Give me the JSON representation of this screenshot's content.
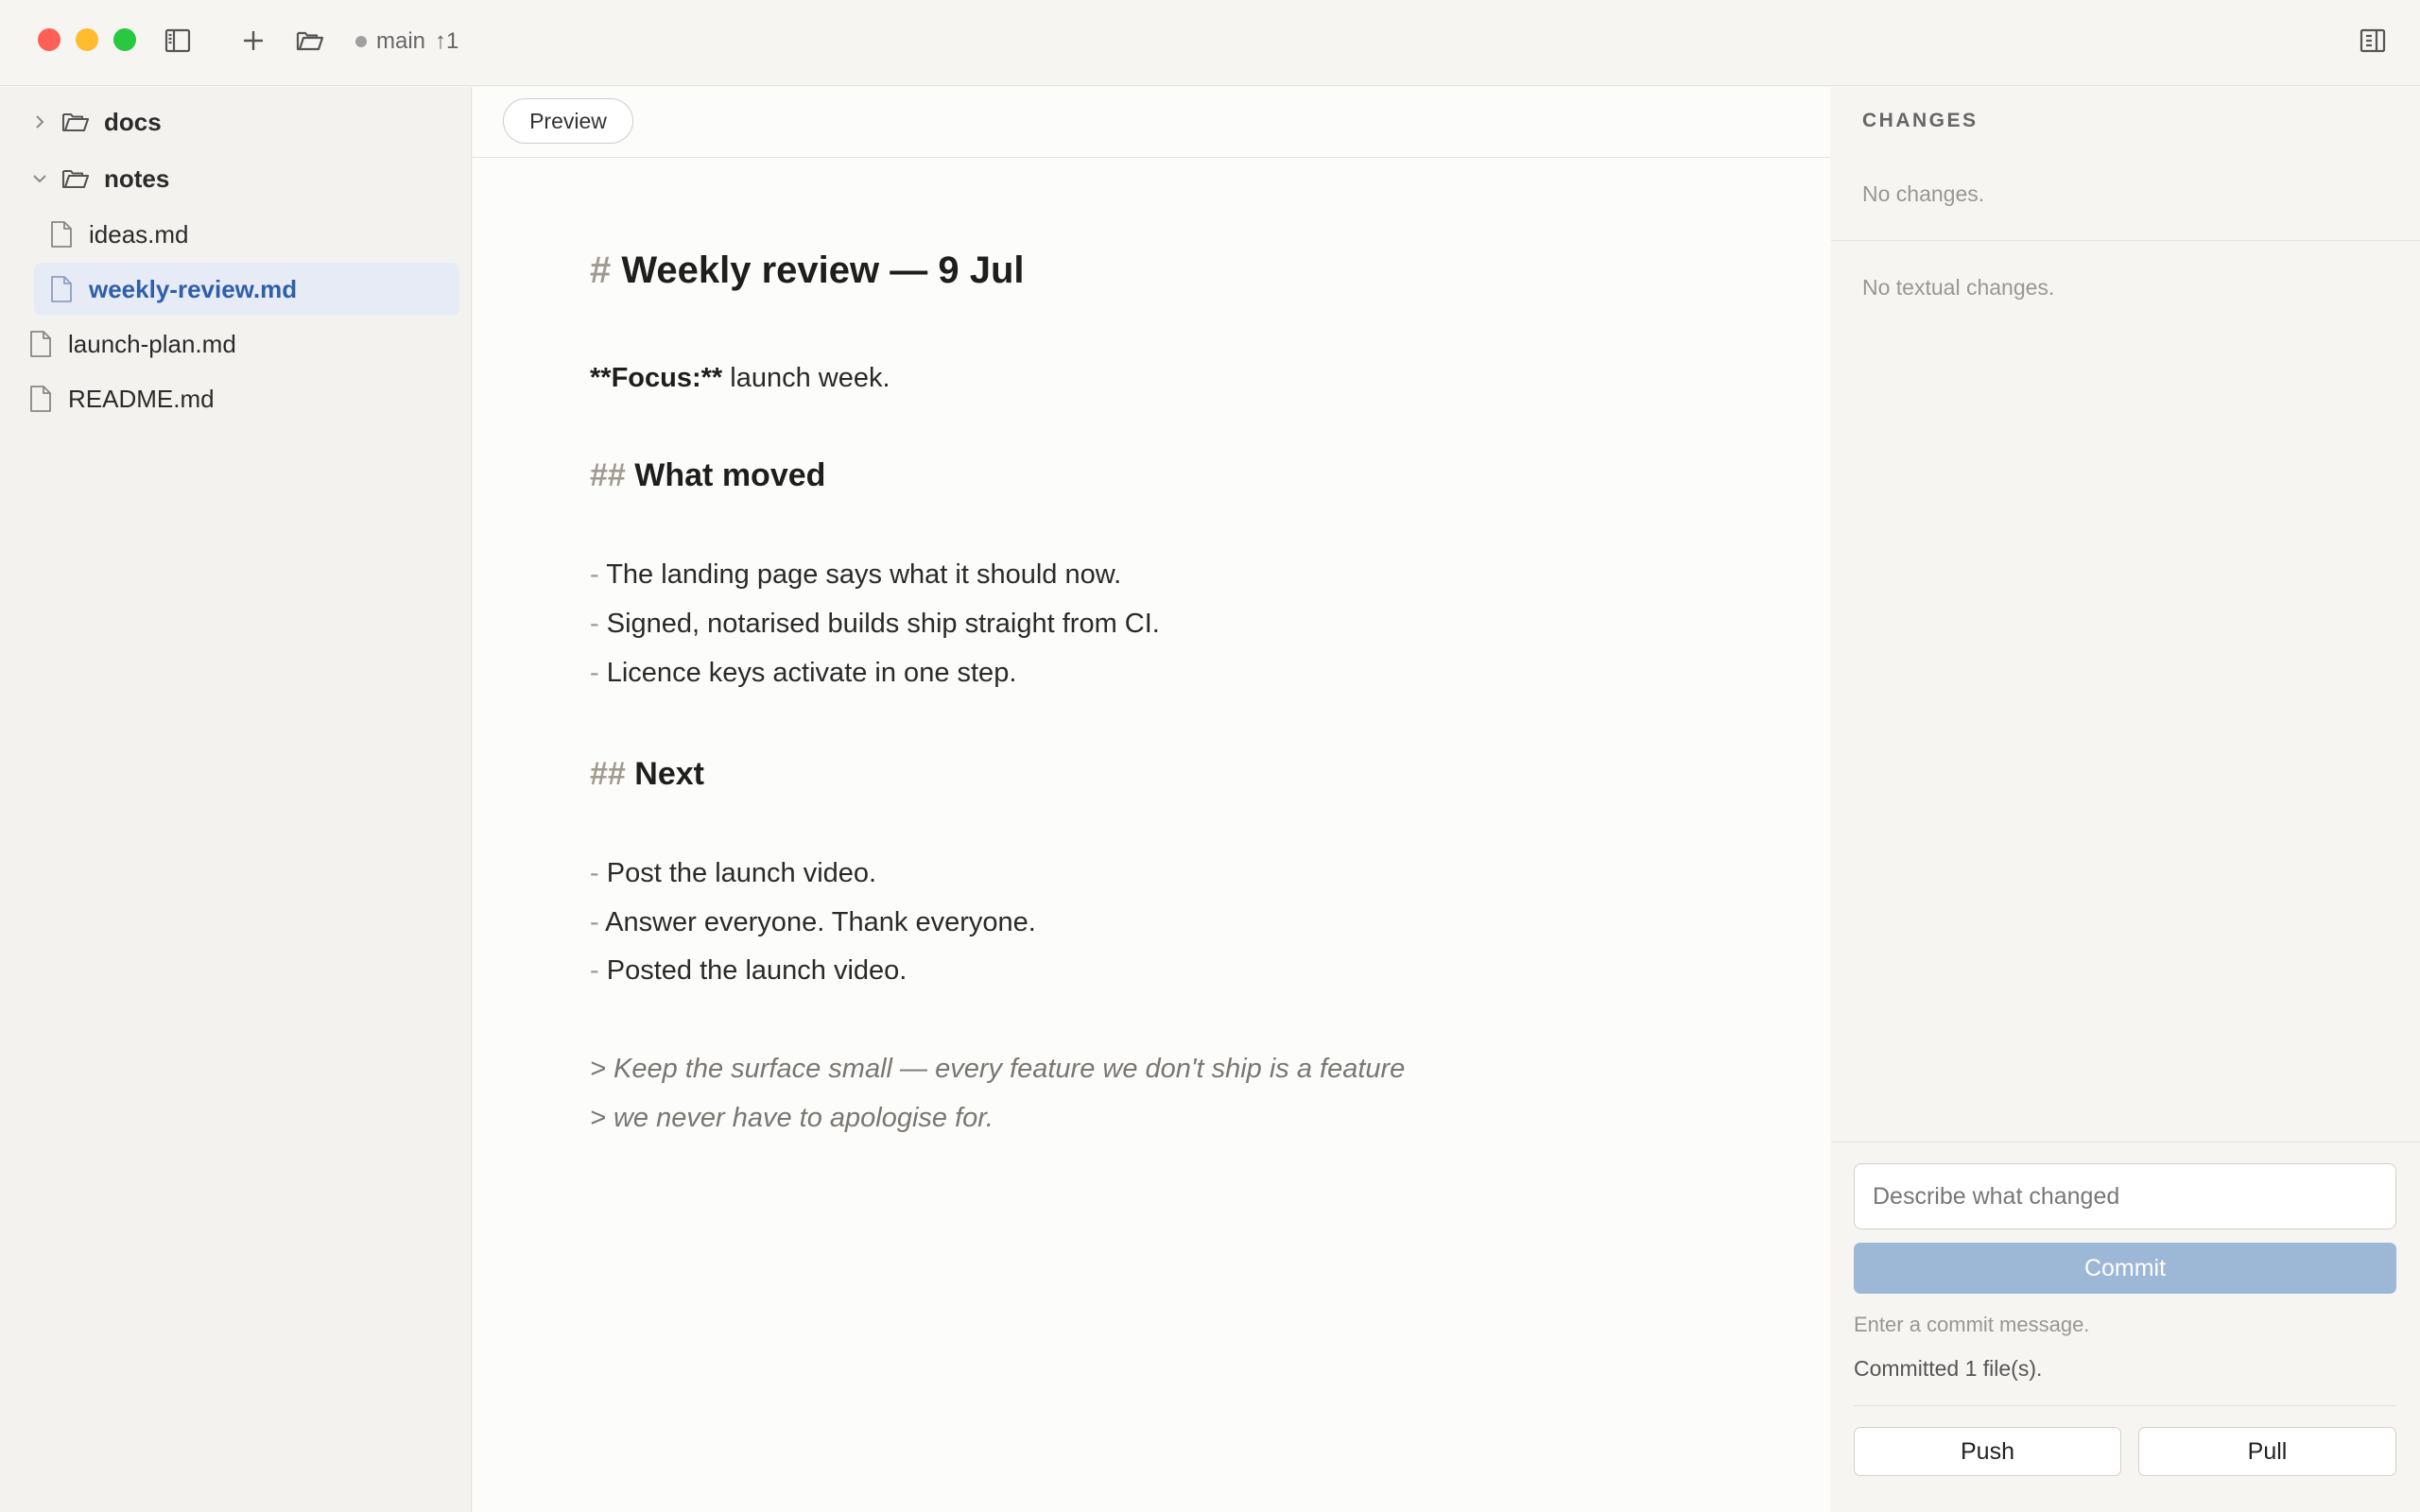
{
  "titlebar": {
    "branch": "main",
    "ahead": "↑1"
  },
  "sidebar": {
    "items": [
      {
        "label": "docs",
        "type": "folder",
        "expanded": false
      },
      {
        "label": "notes",
        "type": "folder",
        "expanded": true
      },
      {
        "label": "ideas.md",
        "type": "file"
      },
      {
        "label": "weekly-review.md",
        "type": "file",
        "selected": true
      },
      {
        "label": "launch-plan.md",
        "type": "file"
      },
      {
        "label": "README.md",
        "type": "file"
      }
    ]
  },
  "editor": {
    "preview_label": "Preview",
    "lines": [
      {
        "mark": "#",
        "text": "Weekly review — 9 Jul"
      },
      {
        "bold": "**Focus:**",
        "text": " launch week."
      },
      {
        "mark": "##",
        "text": "What moved"
      },
      {
        "mark": "-",
        "text": "The landing page says what it should now."
      },
      {
        "mark": "-",
        "text": "Signed, notarised builds ship straight from CI."
      },
      {
        "mark": "-",
        "text": "Licence keys activate in one step."
      },
      {
        "mark": "##",
        "text": "Next"
      },
      {
        "mark": "-",
        "text": "Post the launch video."
      },
      {
        "mark": "-",
        "text": "Answer everyone. Thank everyone."
      },
      {
        "mark": "-",
        "text": "Posted the launch video."
      },
      {
        "text": "> Keep the surface small — every feature we don't ship is a feature"
      },
      {
        "text": "> we never have to apologise for."
      }
    ]
  },
  "changes": {
    "title": "CHANGES",
    "no_changes": "No changes.",
    "no_textual": "No textual changes.",
    "commit_placeholder": "Describe what changed",
    "commit_label": "Commit",
    "hint": "Enter a commit message.",
    "status": "Committed 1 file(s).",
    "push_label": "Push",
    "pull_label": "Pull"
  },
  "colors": {
    "accent": "#2f5fa8",
    "commit_disabled": "#9db7d6",
    "close": "#fe5f57",
    "minimize": "#febc2e",
    "maximize": "#28c840"
  }
}
